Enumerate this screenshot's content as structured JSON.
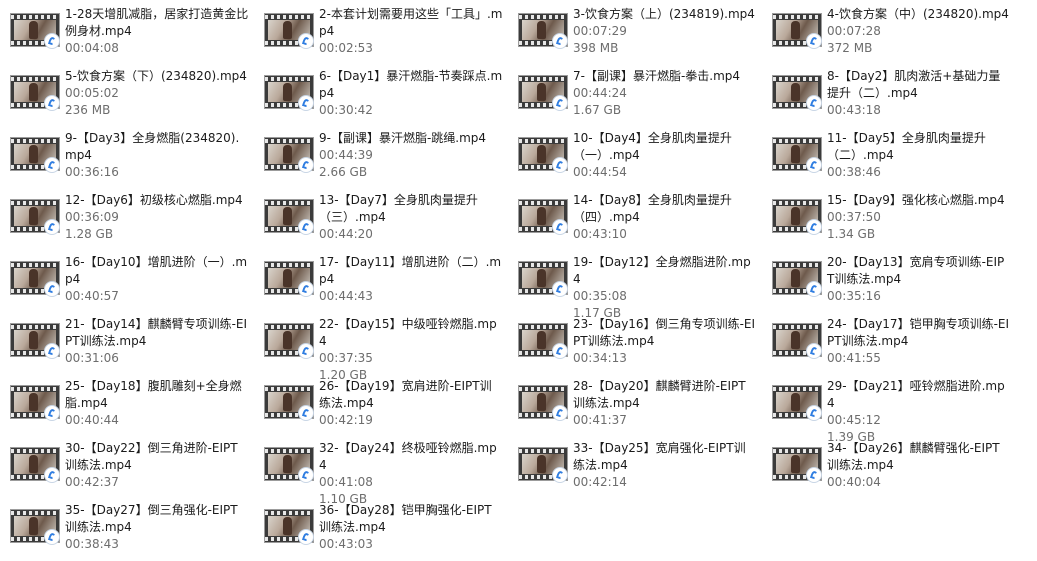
{
  "files": [
    {
      "name": "1-28天增肌减脂，居家打造黄金比例身材.mp4",
      "duration": "00:04:08",
      "size": ""
    },
    {
      "name": "2-本套计划需要用这些「工具」.mp4",
      "duration": "00:02:53",
      "size": ""
    },
    {
      "name": "3-饮食方案（上）(234819).mp4",
      "duration": "00:07:29",
      "size": "398 MB"
    },
    {
      "name": "4-饮食方案（中）(234820).mp4",
      "duration": "00:07:28",
      "size": "372 MB"
    },
    {
      "name": "5-饮食方案（下）(234820).mp4",
      "duration": "00:05:02",
      "size": "236 MB"
    },
    {
      "name": "6-【Day1】暴汗燃脂-节奏踩点.mp4",
      "duration": "00:30:42",
      "size": ""
    },
    {
      "name": "7-【副课】暴汗燃脂-拳击.mp4",
      "duration": "00:44:24",
      "size": "1.67 GB"
    },
    {
      "name": "8-【Day2】肌肉激活+基础力量提升（二）.mp4",
      "duration": "00:43:18",
      "size": ""
    },
    {
      "name": "9-【Day3】全身燃脂(234820).mp4",
      "duration": "00:36:16",
      "size": ""
    },
    {
      "name": "9-【副课】暴汗燃脂-跳绳.mp4",
      "duration": "00:44:39",
      "size": "2.66 GB"
    },
    {
      "name": "10-【Day4】全身肌肉量提升（一）.mp4",
      "duration": "00:44:54",
      "size": ""
    },
    {
      "name": "11-【Day5】全身肌肉量提升（二）.mp4",
      "duration": "00:38:46",
      "size": ""
    },
    {
      "name": "12-【Day6】初级核心燃脂.mp4",
      "duration": "00:36:09",
      "size": "1.28 GB"
    },
    {
      "name": "13-【Day7】全身肌肉量提升（三）.mp4",
      "duration": "00:44:20",
      "size": ""
    },
    {
      "name": "14-【Day8】全身肌肉量提升（四）.mp4",
      "duration": "00:43:10",
      "size": ""
    },
    {
      "name": "15-【Day9】强化核心燃脂.mp4",
      "duration": "00:37:50",
      "size": "1.34 GB"
    },
    {
      "name": "16-【Day10】增肌进阶（一）.mp4",
      "duration": "00:40:57",
      "size": ""
    },
    {
      "name": "17-【Day11】增肌进阶（二）.mp4",
      "duration": "00:44:43",
      "size": ""
    },
    {
      "name": "19-【Day12】全身燃脂进阶.mp4",
      "duration": "00:35:08",
      "size": "1.17 GB"
    },
    {
      "name": "20-【Day13】宽肩专项训练-EIPT训练法.mp4",
      "duration": "00:35:16",
      "size": ""
    },
    {
      "name": "21-【Day14】麒麟臂专项训练-EIPT训练法.mp4",
      "duration": "00:31:06",
      "size": ""
    },
    {
      "name": "22-【Day15】中级哑铃燃脂.mp4",
      "duration": "00:37:35",
      "size": "1.20 GB"
    },
    {
      "name": "23-【Day16】倒三角专项训练-EIPT训练法.mp4",
      "duration": "00:34:13",
      "size": ""
    },
    {
      "name": "24-【Day17】铠甲胸专项训练-EIPT训练法.mp4",
      "duration": "00:41:55",
      "size": ""
    },
    {
      "name": "25-【Day18】腹肌雕刻+全身燃脂.mp4",
      "duration": "00:40:44",
      "size": ""
    },
    {
      "name": "26-【Day19】宽肩进阶-EIPT训练法.mp4",
      "duration": "00:42:19",
      "size": ""
    },
    {
      "name": "28-【Day20】麒麟臂进阶-EIPT训练法.mp4",
      "duration": "00:41:37",
      "size": ""
    },
    {
      "name": "29-【Day21】哑铃燃脂进阶.mp4",
      "duration": "00:45:12",
      "size": "1.39 GB"
    },
    {
      "name": "30-【Day22】倒三角进阶-EIPT训练法.mp4",
      "duration": "00:42:37",
      "size": ""
    },
    {
      "name": "32-【Day24】终极哑铃燃脂.mp4",
      "duration": "00:41:08",
      "size": "1.10 GB"
    },
    {
      "name": "33-【Day25】宽肩强化-EIPT训练法.mp4",
      "duration": "00:42:14",
      "size": ""
    },
    {
      "name": "34-【Day26】麒麟臂强化-EIPT训练法.mp4",
      "duration": "00:40:04",
      "size": ""
    },
    {
      "name": "35-【Day27】倒三角强化-EIPT训练法.mp4",
      "duration": "00:38:43",
      "size": ""
    },
    {
      "name": "36-【Day28】铠甲胸强化-EIPT训练法.mp4",
      "duration": "00:43:03",
      "size": ""
    }
  ]
}
